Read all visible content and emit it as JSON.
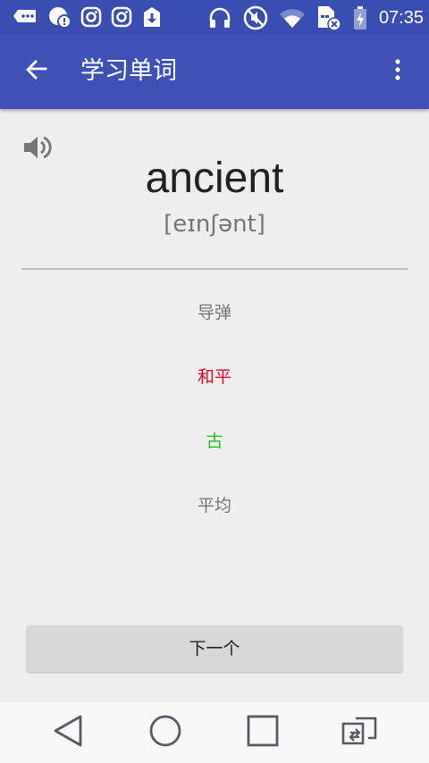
{
  "status_bar": {
    "time": "07:35",
    "left_icons": [
      "messages-icon",
      "notification-alert-icon",
      "instagram-icon",
      "instagram-icon",
      "download-icon"
    ],
    "right_icons": [
      "headphones-icon",
      "mute-icon",
      "wifi-icon",
      "sim-card-icon",
      "battery-icon"
    ]
  },
  "app_bar": {
    "title": "学习单词",
    "back_icon": "arrow-back-icon",
    "menu_icon": "more-vert-icon"
  },
  "word_card": {
    "speaker_icon": "volume-icon",
    "word": "ancient",
    "phonetic": "[eɪnʃənt]"
  },
  "options": [
    {
      "label": "导弹",
      "color": "#757575"
    },
    {
      "label": "和平",
      "color": "#e8002d"
    },
    {
      "label": "古",
      "color": "#1fc11f"
    },
    {
      "label": "平均",
      "color": "#757575"
    }
  ],
  "next_button": {
    "label": "下一个"
  },
  "nav_bar": {
    "icons": [
      "back-triangle-icon",
      "home-circle-icon",
      "recents-square-icon",
      "rotate-switch-icon"
    ]
  },
  "colors": {
    "status_bar": "#3a4db0",
    "app_bar": "#3f51b5",
    "background": "#eeeeee",
    "wrong_answer": "#e8002d",
    "correct_answer": "#1fc11f"
  }
}
